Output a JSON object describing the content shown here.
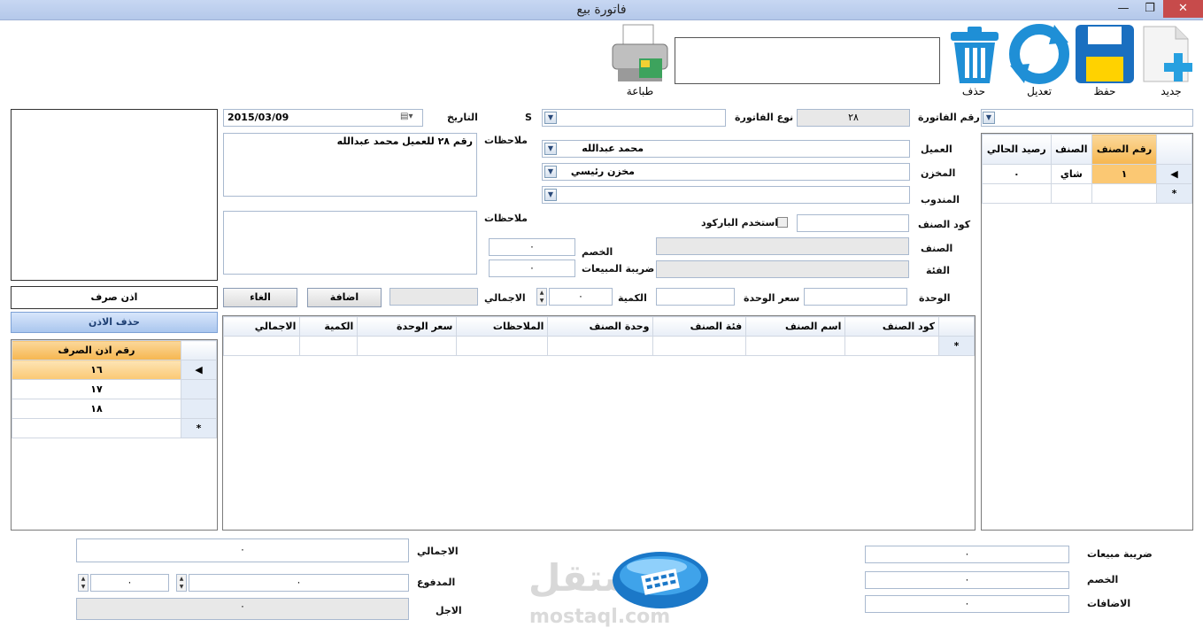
{
  "window": {
    "title": "فاتورة بيع",
    "minimize": "—",
    "restore": "❐",
    "close": "✕"
  },
  "toolbar": {
    "new": "جديد",
    "save": "حفظ",
    "edit": "تعديل",
    "delete": "حذف",
    "print": "طباعة"
  },
  "invoice": {
    "number_label": "رقم الفاتورة",
    "number_value": "٢٨",
    "type_label": "نوع الفاتورة",
    "s_value": "S",
    "date_label": "التاريخ",
    "date_value": "2015/03/09",
    "notes_label": "ملاحظات",
    "notes_value": "رقم ٢٨ للعميل محمد عبدالله",
    "notes2_label": "ملاحظات",
    "customer_label": "العميل",
    "customer_value": "محمد عبدالله",
    "store_label": "المخزن",
    "store_value": "مخزن رئيسي",
    "rep_label": "المندوب",
    "item_code_label": "كود الصنف",
    "barcode_label": "استخدم الباركود",
    "item_label": "الصنف",
    "category_label": "الفئة",
    "unit_label": "الوحدة",
    "discount_label": "الخصم",
    "discount_value": "٠",
    "tax_label": "ضريبة المبيعات",
    "tax_value": "٠",
    "unit_price_label": "سعر الوحدة",
    "quantity_label": "الكمية",
    "quantity_value": "٠",
    "total_label": "الاجمالي",
    "add_button": "اضافة",
    "cancel_button": "الغاء"
  },
  "lines_grid": {
    "columns": [
      "كود الصنف",
      "اسم الصنف",
      "فئة الصنف",
      "وحدة الصنف",
      "الملاحظات",
      "سعر الوحدة",
      "الكمية",
      "الاجمالي"
    ],
    "new_row_marker": "*"
  },
  "stock_grid": {
    "columns": [
      "رقم الصنف",
      "الصنف",
      "رصيد الحالي"
    ],
    "rows": [
      {
        "num": "١",
        "name": "شاي",
        "balance": "٠"
      }
    ],
    "current_marker": "◀",
    "new_row_marker": "*"
  },
  "permit": {
    "label": "اذن صرف",
    "delete_button": "حذف الاذن",
    "grid_header": "رقم اذن الصرف",
    "rows": [
      "١٦",
      "١٧",
      "١٨"
    ],
    "current_marker": "◀",
    "new_row_marker": "*"
  },
  "totals": {
    "tax_label": "ضريبة مبيعات",
    "tax_value": "٠",
    "discount_label": "الخصم",
    "discount_value": "٠",
    "additions_label": "الاضافات",
    "additions_value": "٠",
    "total_label": "الاجمالي",
    "total_value": "٠",
    "paid_label": "المدفوع",
    "paid_value": "٠",
    "paid_extra_value": "٠",
    "remaining_label": "الاجل",
    "remaining_value": "٠"
  },
  "watermark": {
    "text": "مستقل",
    "domain": "mostaql.com"
  },
  "colors": {
    "accent": "#1f8fd6",
    "selected_row": "#fbc873",
    "titlebar": "#b4c8ea",
    "close": "#c74b4b"
  }
}
